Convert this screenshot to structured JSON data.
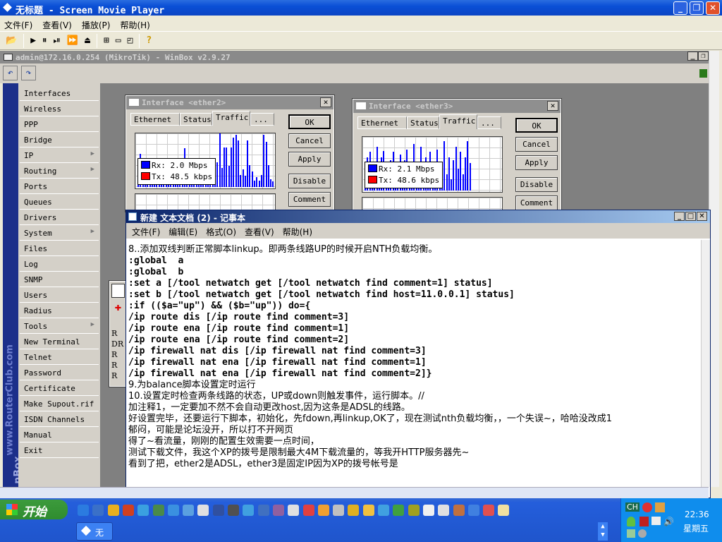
{
  "player": {
    "title": "无标题 - Screen Movie Player",
    "menu": [
      "文件(F)",
      "查看(V)",
      "播放(P)",
      "帮助(H)"
    ],
    "toolbar": [
      "open-icon",
      "play-icon",
      "pause-icon",
      "step-icon",
      "fast-forward-icon",
      "eject-icon",
      "fit-icon",
      "window-icon",
      "fullscreen-icon",
      "help-icon"
    ]
  },
  "winbox": {
    "title": "admin@172.16.0.254 (MikroTik) - WinBox v2.9.27",
    "brand": "www.RouterClub.com",
    "brand_short": "nBox",
    "sidebar": [
      {
        "label": "Interfaces"
      },
      {
        "label": "Wireless"
      },
      {
        "label": "PPP"
      },
      {
        "label": "Bridge"
      },
      {
        "label": "IP",
        "sub": true
      },
      {
        "label": "Routing",
        "sub": true
      },
      {
        "label": "Ports"
      },
      {
        "label": "Queues"
      },
      {
        "label": "Drivers"
      },
      {
        "label": "System",
        "sub": true
      },
      {
        "label": "Files"
      },
      {
        "label": "Log"
      },
      {
        "label": "SNMP"
      },
      {
        "label": "Users"
      },
      {
        "label": "Radius"
      },
      {
        "label": "Tools",
        "sub": true
      },
      {
        "label": "New Terminal"
      },
      {
        "label": "Telnet"
      },
      {
        "label": "Password"
      },
      {
        "label": "Certificate"
      },
      {
        "label": "Make Supout.rif"
      },
      {
        "label": "ISDN Channels"
      },
      {
        "label": "Manual"
      },
      {
        "label": "Exit"
      }
    ],
    "status_color": "#2a7a1a",
    "windows": [
      {
        "title": "Interface <ether2>",
        "tabs": [
          "Ethernet",
          "Status",
          "Traffic",
          "..."
        ],
        "active_tab": "Traffic",
        "rx": "Rx: 2.0 Mbps",
        "tx": "Tx: 48.5 kbps",
        "buttons": [
          "OK",
          "Cancel",
          "Apply",
          "Disable",
          "Comment"
        ]
      },
      {
        "title": "Interface <ether3>",
        "tabs": [
          "Ethernet",
          "Status",
          "Traffic",
          "..."
        ],
        "active_tab": "Traffic",
        "rx": "Rx: 2.1 Mbps",
        "tx": "Tx: 48.6 kbps",
        "buttons": [
          "OK",
          "Cancel",
          "Apply",
          "Disable",
          "Comment"
        ]
      }
    ],
    "rx_color": "#0000ff",
    "tx_color": "#ff0000",
    "route_list_flags": [
      "R",
      "DR",
      "R",
      "R",
      "R"
    ]
  },
  "notepad": {
    "title": "新建 文本文档 (2) - 记事本",
    "menu": [
      "文件(F)",
      "编辑(E)",
      "格式(O)",
      "查看(V)",
      "帮助(H)"
    ],
    "lines": [
      "8..添加双线判断正常脚本linkup。即两条线路UP的时候开启NTH负载均衡。",
      ":global  a",
      ":global  b",
      ":set a [/tool netwatch get [/tool netwatch find comment=1] status]",
      ":set b [/tool netwatch get [/tool netwatch find host=11.0.0.1] status]",
      ":if (($a=\"up\") && ($b=\"up\")) do={",
      "/ip route dis [/ip route find comment=3]",
      "/ip route ena [/ip route find comment=1]",
      "/ip route ena [/ip route find comment=2]",
      "/ip firewall nat dis [/ip firewall nat find comment=3]",
      "/ip firewall nat ena [/ip firewall nat find comment=1]",
      "/ip firewall nat ena [/ip firewall nat find comment=2]}",
      "9.为balance脚本设置定时运行",
      "10.设置定时检查两条线路的状态，UP或down则触发事件，运行脚本。//",
      "加注释1，一定要加不然不会自动更改host,因为这条是ADSL的线路。",
      "好设置完毕，还要运行下脚本，初始化，先fdown,再linkup,OK了，现在测试nth负载均衡，，一个失误~，哈哈没改成1",
      "郁闷，可能是论坛没开，所以打不开网页",
      "得了~看流量，刚刚的配置生效需要一点时间，",
      "测试下载文件，我这个XP的拨号是限制最大4M下载流量的，等我开HTTP服务器先~",
      "看到了把，ether2是ADSL，ether3是固定IP因为XP的拨号帐号是"
    ]
  },
  "taskbar": {
    "start": "开始",
    "task": "无",
    "tray_lang": "CH",
    "time": "22:36",
    "day": "星期五",
    "quicklaunch": [
      "#2b7be0",
      "#3a70c8",
      "#e8b020",
      "#d04020",
      "#3aa0e0",
      "#4a8a4a",
      "#3a90e0",
      "#5aa0e0",
      "#e0e0e0",
      "#3050a0",
      "#505050",
      "#40a0e0",
      "#4070c0",
      "#9060a0",
      "#e0e0e0",
      "#e04040",
      "#f0a030",
      "#c0c0c0",
      "#e0b020",
      "#f0c040",
      "#40a0e0",
      "#40a040",
      "#a0a020",
      "#f0f0f0",
      "#e0e0e0",
      "#c07040",
      "#4080e0",
      "#e05050",
      "#f0e0a0"
    ]
  }
}
